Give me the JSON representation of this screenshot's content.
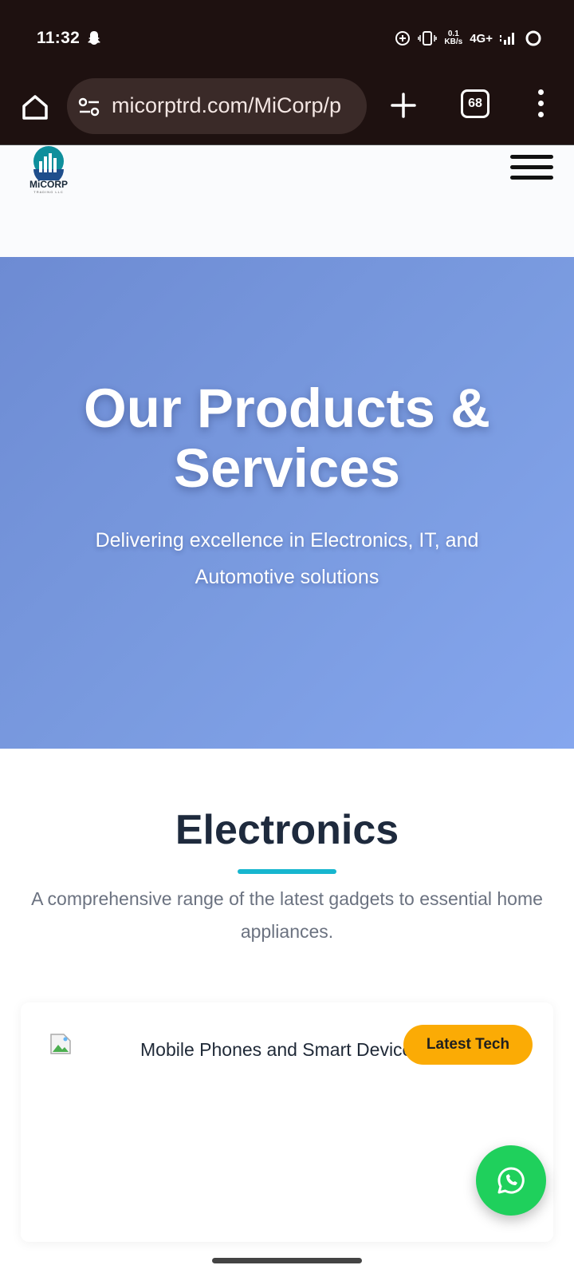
{
  "status_bar": {
    "time": "11:32",
    "net_speed_value": "0.1",
    "net_speed_unit": "KB/s",
    "network_type": "4G+"
  },
  "browser": {
    "url": "micorptrd.com/MiCorp/p",
    "tab_count": "68"
  },
  "site": {
    "logo_text": "MiCORP",
    "logo_subtext": "TRADING LLC"
  },
  "hero": {
    "title": "Our Products & Services",
    "subtitle": "Delivering excellence in Electronics, IT, and Automotive solutions"
  },
  "electronics": {
    "title": "Electronics",
    "description": "A comprehensive range of the latest gadgets to essential home appliances.",
    "card": {
      "title": "Mobile Phones and Smart Devices",
      "badge": "Latest Tech"
    }
  },
  "colors": {
    "accent_underline": "#17b6cf",
    "badge": "#fbab05",
    "whatsapp": "#1fd05c",
    "hero_gradient_start": "#6d8bd3",
    "hero_gradient_end": "#85a6ee"
  }
}
